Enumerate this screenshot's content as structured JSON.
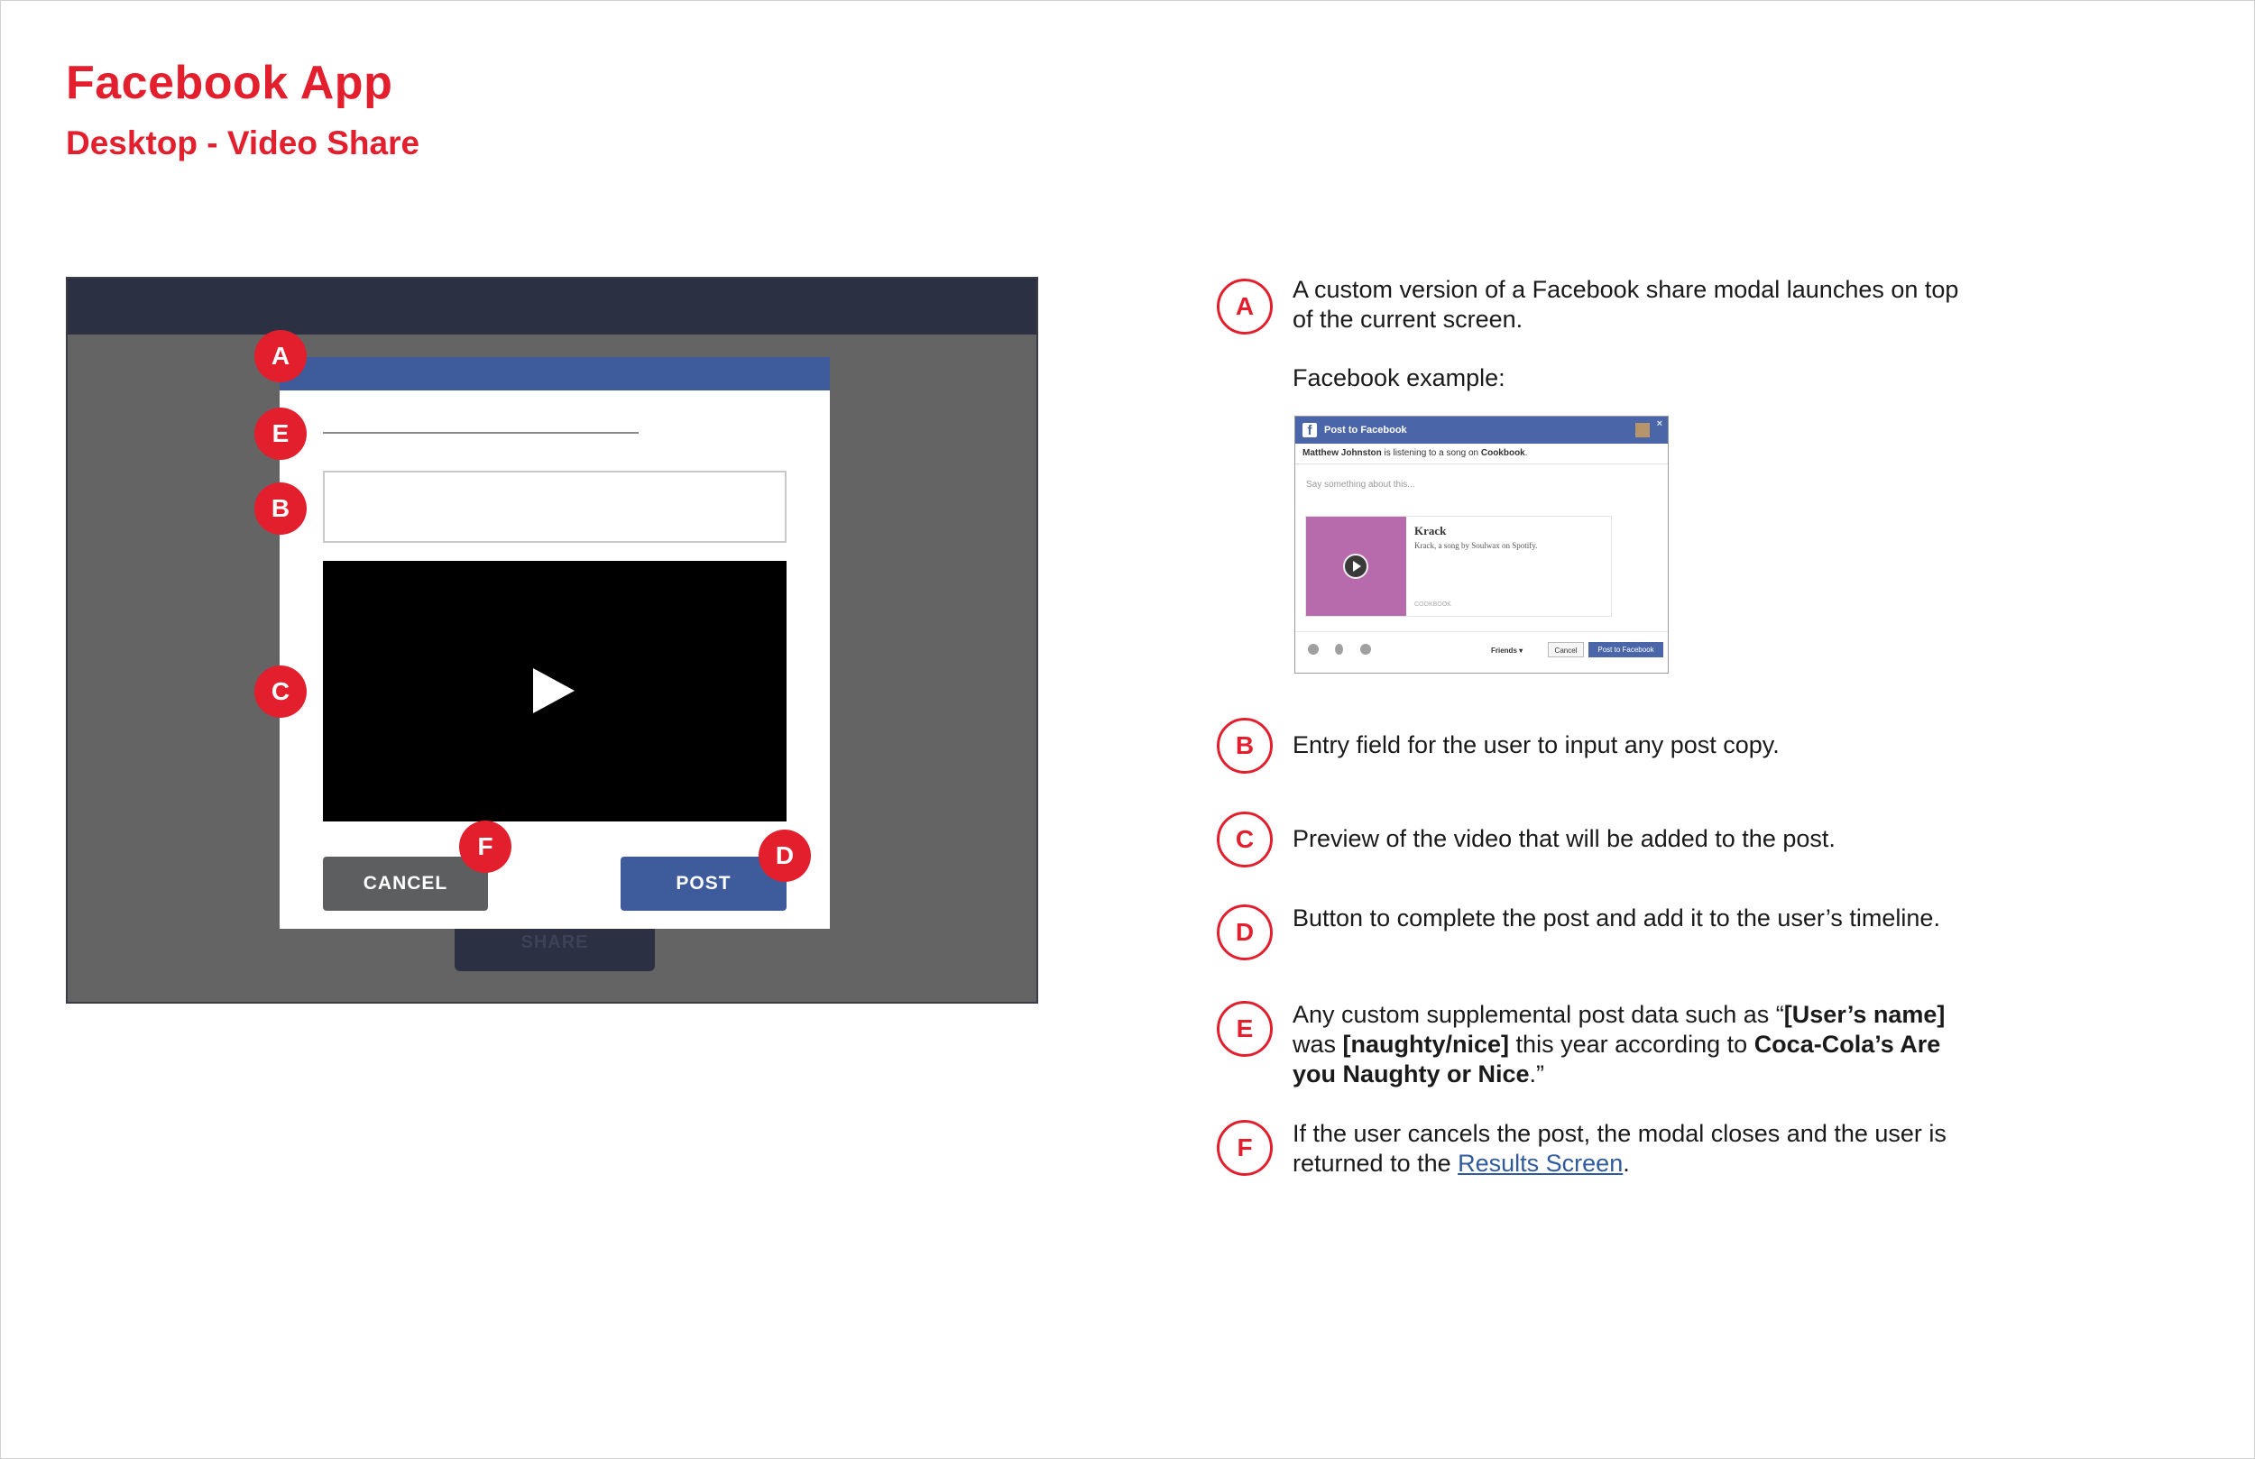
{
  "header": {
    "title": "Facebook App",
    "subtitle": "Desktop - Video Share"
  },
  "mockup": {
    "background_button_label": "SHARE",
    "cancel_label": "CANCEL",
    "post_label": "POST",
    "markers": {
      "a": "A",
      "b": "B",
      "c": "C",
      "d": "D",
      "e": "E",
      "f": "F"
    }
  },
  "notes": [
    {
      "marker": "A",
      "text": "A custom version of a Facebook share modal launches on top of the current screen.",
      "example_label": "Facebook example:"
    },
    {
      "marker": "B",
      "text": "Entry field for the user to input any post copy."
    },
    {
      "marker": "C",
      "text": "Preview of the video that will be added to the post."
    },
    {
      "marker": "D",
      "text": "Button to complete the post and add it to the user’s timeline."
    },
    {
      "marker": "E",
      "parts": [
        "Any custom supplemental post data such as “",
        "[User’s name]",
        " was ",
        "[naughty/nice]",
        " this year according to ",
        "Coca-Cola’s Are you Naughty or Nice",
        ".”"
      ]
    },
    {
      "marker": "F",
      "text_before": "If the user cancels the post, the modal closes and the user is returned to the ",
      "link": "Results Screen",
      "text_after": "."
    }
  ],
  "fb_example": {
    "logo": "f",
    "header_title": "Post to Facebook",
    "close": "×",
    "attribution_name": "Matthew Johnston",
    "attribution_mid": " is listening to a song on ",
    "attribution_app": "Cookbook",
    "attribution_end": ".",
    "placeholder": "Say something about this...",
    "card_title": "Krack",
    "card_desc": "Krack, a song by Soulwax on Spotify.",
    "card_source": "COOKBOOK",
    "audience": "Friends ▾",
    "cancel": "Cancel",
    "post": "Post to Facebook"
  },
  "colors": {
    "accent_red": "#e31e2d",
    "facebook_blue": "#3e5b9b",
    "overlay_gray": "#646464",
    "navbar_dark": "#2b3143"
  }
}
